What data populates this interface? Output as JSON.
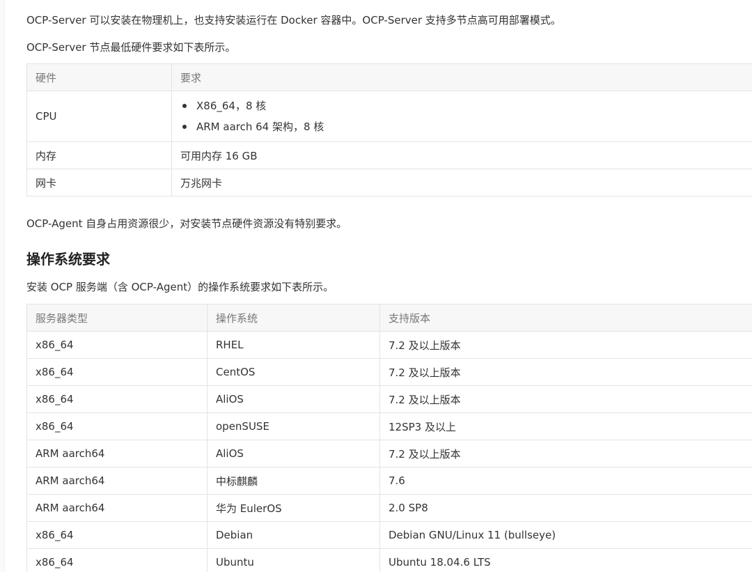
{
  "intro": {
    "para1": "OCP-Server 可以安装在物理机上，也支持安装运行在 Docker 容器中。OCP-Server 支持多节点高可用部署模式。",
    "para2": "OCP-Server 节点最低硬件要求如下表所示。"
  },
  "hardware_table": {
    "headers": [
      "硬件",
      "要求"
    ],
    "rows": [
      {
        "item": "CPU",
        "reqs": [
          "X86_64，8 核",
          "ARM aarch 64 架构，8 核"
        ]
      },
      {
        "item": "内存",
        "req": "可用内存 16 GB"
      },
      {
        "item": "网卡",
        "req": "万兆网卡"
      }
    ]
  },
  "agent_note": "OCP-Agent 自身占用资源很少，对安装节点硬件资源没有特别要求。",
  "os_section": {
    "heading": "操作系统要求",
    "intro": "安装 OCP 服务端（含 OCP-Agent）的操作系统要求如下表所示。"
  },
  "os_table": {
    "headers": [
      "服务器类型",
      "操作系统",
      "支持版本"
    ],
    "rows": [
      [
        "x86_64",
        "RHEL",
        "7.2 及以上版本"
      ],
      [
        "x86_64",
        "CentOS",
        "7.2 及以上版本"
      ],
      [
        "x86_64",
        "AliOS",
        "7.2 及以上版本"
      ],
      [
        "x86_64",
        "openSUSE",
        "12SP3 及以上"
      ],
      [
        "ARM aarch64",
        "AliOS",
        "7.2 及以上版本"
      ],
      [
        "ARM aarch64",
        "中标麒麟",
        "7.6"
      ],
      [
        "ARM aarch64",
        "华为 EulerOS",
        "2.0 SP8"
      ],
      [
        "x86_64",
        "Debian",
        "Debian GNU/Linux 11 (bullseye)"
      ],
      [
        "x86_64",
        "Ubuntu",
        "Ubuntu 18.04.6 LTS"
      ]
    ]
  }
}
